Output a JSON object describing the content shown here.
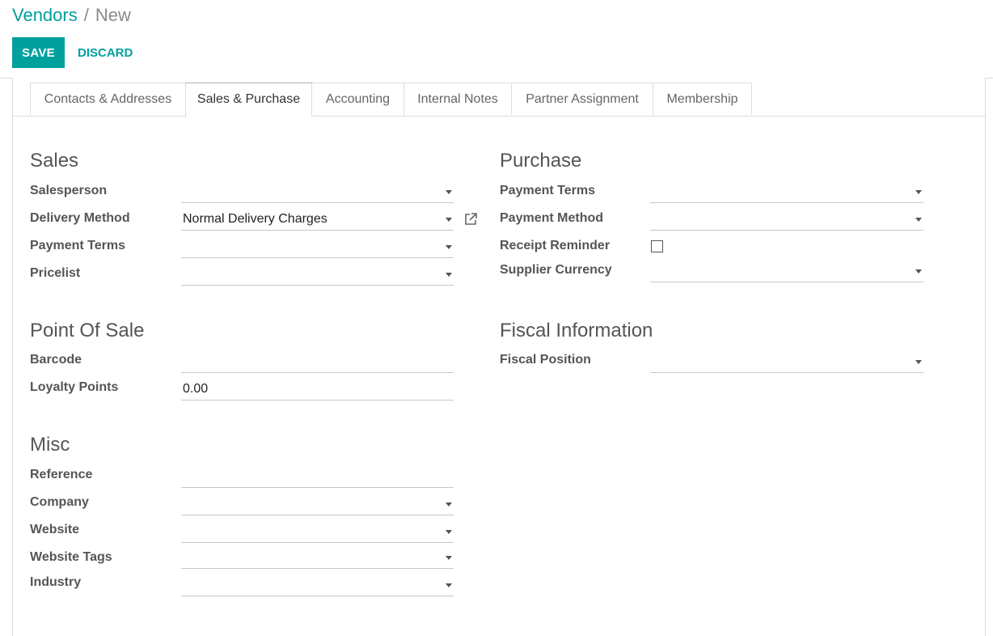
{
  "breadcrumb": {
    "parent": "Vendors",
    "separator": "/",
    "current": "New"
  },
  "buttons": {
    "save": "SAVE",
    "discard": "DISCARD"
  },
  "tabs": [
    {
      "label": "Contacts & Addresses"
    },
    {
      "label": "Sales & Purchase"
    },
    {
      "label": "Accounting"
    },
    {
      "label": "Internal Notes"
    },
    {
      "label": "Partner Assignment"
    },
    {
      "label": "Membership"
    }
  ],
  "active_tab": "Sales & Purchase",
  "sales": {
    "title": "Sales",
    "fields": {
      "salesperson": {
        "label": "Salesperson",
        "value": ""
      },
      "delivery_method": {
        "label": "Delivery Method",
        "value": "Normal Delivery Charges"
      },
      "payment_terms": {
        "label": "Payment Terms",
        "value": ""
      },
      "pricelist": {
        "label": "Pricelist",
        "value": ""
      }
    }
  },
  "purchase": {
    "title": "Purchase",
    "fields": {
      "payment_terms": {
        "label": "Payment Terms",
        "value": ""
      },
      "payment_method": {
        "label": "Payment Method",
        "value": ""
      },
      "receipt_reminder": {
        "label": "Receipt Reminder",
        "checked": false
      },
      "supplier_currency": {
        "label": "Supplier Currency",
        "value": ""
      }
    }
  },
  "point_of_sale": {
    "title": "Point Of Sale",
    "fields": {
      "barcode": {
        "label": "Barcode",
        "value": ""
      },
      "loyalty_points": {
        "label": "Loyalty Points",
        "value": "0.00"
      }
    }
  },
  "fiscal": {
    "title": "Fiscal Information",
    "fields": {
      "fiscal_position": {
        "label": "Fiscal Position",
        "value": ""
      }
    }
  },
  "misc": {
    "title": "Misc",
    "fields": {
      "reference": {
        "label": "Reference",
        "value": ""
      },
      "company": {
        "label": "Company",
        "value": ""
      },
      "website": {
        "label": "Website",
        "value": ""
      },
      "website_tags": {
        "label": "Website Tags",
        "value": ""
      },
      "industry": {
        "label": "Industry",
        "value": ""
      }
    }
  },
  "colors": {
    "accent": "#00a09d",
    "border": "#dcdcdc",
    "label": "#555555"
  }
}
